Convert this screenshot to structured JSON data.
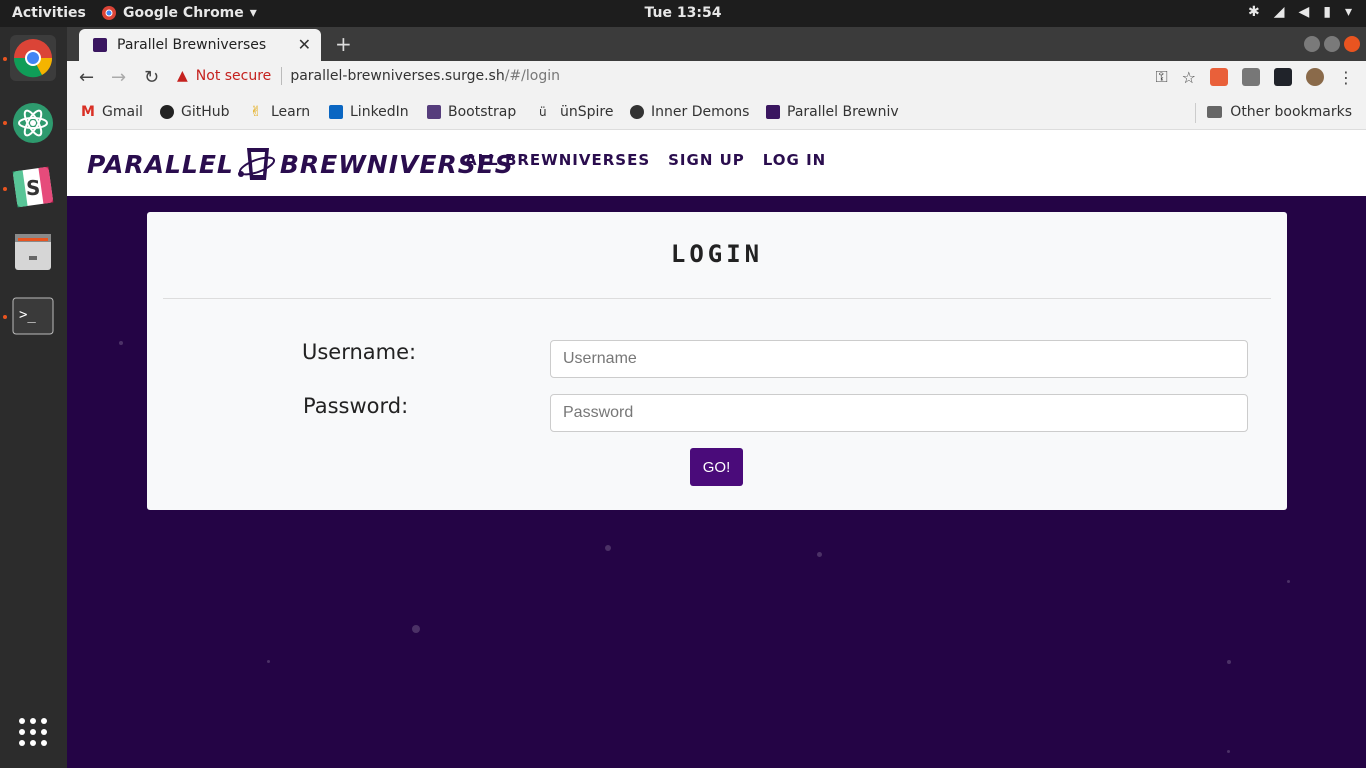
{
  "system": {
    "activities": "Activities",
    "app_name": "Google Chrome",
    "clock": "Tue 13:54"
  },
  "browser": {
    "tab_title": "Parallel Brewniverses",
    "security_label": "Not secure",
    "url_host": "parallel-brewniverses.surge.sh",
    "url_path": "/#/login",
    "bookmarks": [
      {
        "label": "Gmail"
      },
      {
        "label": "GitHub"
      },
      {
        "label": "Learn"
      },
      {
        "label": "LinkedIn"
      },
      {
        "label": "Bootstrap"
      },
      {
        "label": "ünSpire"
      },
      {
        "label": "Inner Demons"
      },
      {
        "label": "Parallel Brewniv"
      }
    ],
    "other_bookmarks": "Other bookmarks"
  },
  "site": {
    "logo_left": "PARALLEL",
    "logo_right": "BREWNIVERSES",
    "nav": {
      "all": "ALL BREWNIVERSES",
      "signup": "SIGN UP",
      "login": "LOG IN"
    },
    "colors": {
      "brand": "#240445",
      "button": "#4a0b7a"
    }
  },
  "login": {
    "title": "LOGIN",
    "username_label": "Username:",
    "username_placeholder": "Username",
    "password_label": "Password:",
    "password_placeholder": "Password",
    "submit": "GO!"
  }
}
